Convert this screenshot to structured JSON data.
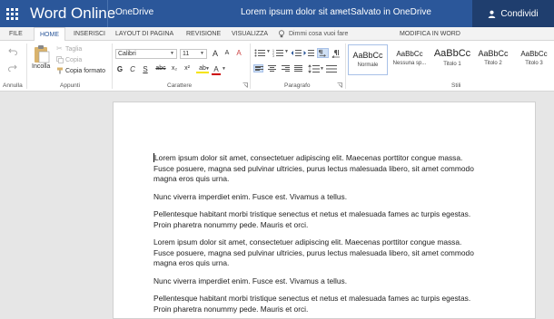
{
  "topbar": {
    "app_title": "Word Online",
    "onedrive": "OneDrive",
    "doc_title": "Lorem ipsum dolor sit amet",
    "doc_dash": "-",
    "doc_status": "Salvato in OneDrive",
    "share_label": "Condividi",
    "colors": {
      "brand": "#2b579a",
      "share_bg": "#1f3e6e"
    }
  },
  "tabs": [
    {
      "label": "FILE"
    },
    {
      "label": "HOME"
    },
    {
      "label": "INSERISCI"
    },
    {
      "label": "LAYOUT DI PAGINA"
    },
    {
      "label": "REVISIONE"
    },
    {
      "label": "VISUALIZZA"
    },
    {
      "label": "Dimmi cosa vuoi fare"
    },
    {
      "label": "MODIFICA IN WORD"
    }
  ],
  "ribbon": {
    "groups": {
      "annulla": "Annulla",
      "appunti": "Appunti",
      "carattere": "Carattere",
      "paragrafo": "Paragrafo",
      "stili": "Stili"
    },
    "clipboard": {
      "paste": "Incolla",
      "cut": "Taglia",
      "copy": "Copia",
      "format_painter": "Copia formato"
    },
    "font": {
      "name": "Calibri",
      "size": "11",
      "bold": "G",
      "italic": "C",
      "underline": "S",
      "strike": "abc",
      "subscript": "x₂",
      "superscript": "x²",
      "grow": "A",
      "shrink": "A",
      "clear": "A",
      "highlight": "ab",
      "color": "A"
    },
    "styles": [
      {
        "sample": "AaBbCc",
        "name": "Normale"
      },
      {
        "sample": "AaBbCc",
        "name": "Nessuna sp..."
      },
      {
        "sample": "AaBbCc",
        "name": "Titolo 1"
      },
      {
        "sample": "AaBbCc",
        "name": "Titolo 2"
      },
      {
        "sample": "AaBbCc",
        "name": "Titolo 3"
      }
    ]
  },
  "document": {
    "p1a": "Lorem ipsum dolor sit amet, consectetuer adipiscing elit. Maecenas porttitor congue massa.",
    "p1b": "Fusce posuere, magna sed pulvinar ultricies, purus lectus malesuada libero, sit amet commodo",
    "p1c": "magna eros quis urna.",
    "p2": "Nunc viverra imperdiet enim. Fusce est. Vivamus a tellus.",
    "p3a": "Pellentesque habitant morbi tristique senectus et netus et malesuada fames ac turpis egestas.",
    "p3b": "Proin pharetra nonummy pede. Mauris et orci.",
    "p4a": "Lorem ipsum dolor sit amet, consectetuer adipiscing elit. Maecenas porttitor congue massa.",
    "p4b": "Fusce posuere, magna sed pulvinar ultricies, purus lectus malesuada libero, sit amet commodo",
    "p4c": "magna eros quis urna.",
    "p5": "Nunc viverra imperdiet enim. Fusce est. Vivamus a tellus.",
    "p6a": "Pellentesque habitant morbi tristique senectus et netus et malesuada fames ac turpis egestas.",
    "p6b": "Proin pharetra nonummy pede. Mauris et orci."
  }
}
